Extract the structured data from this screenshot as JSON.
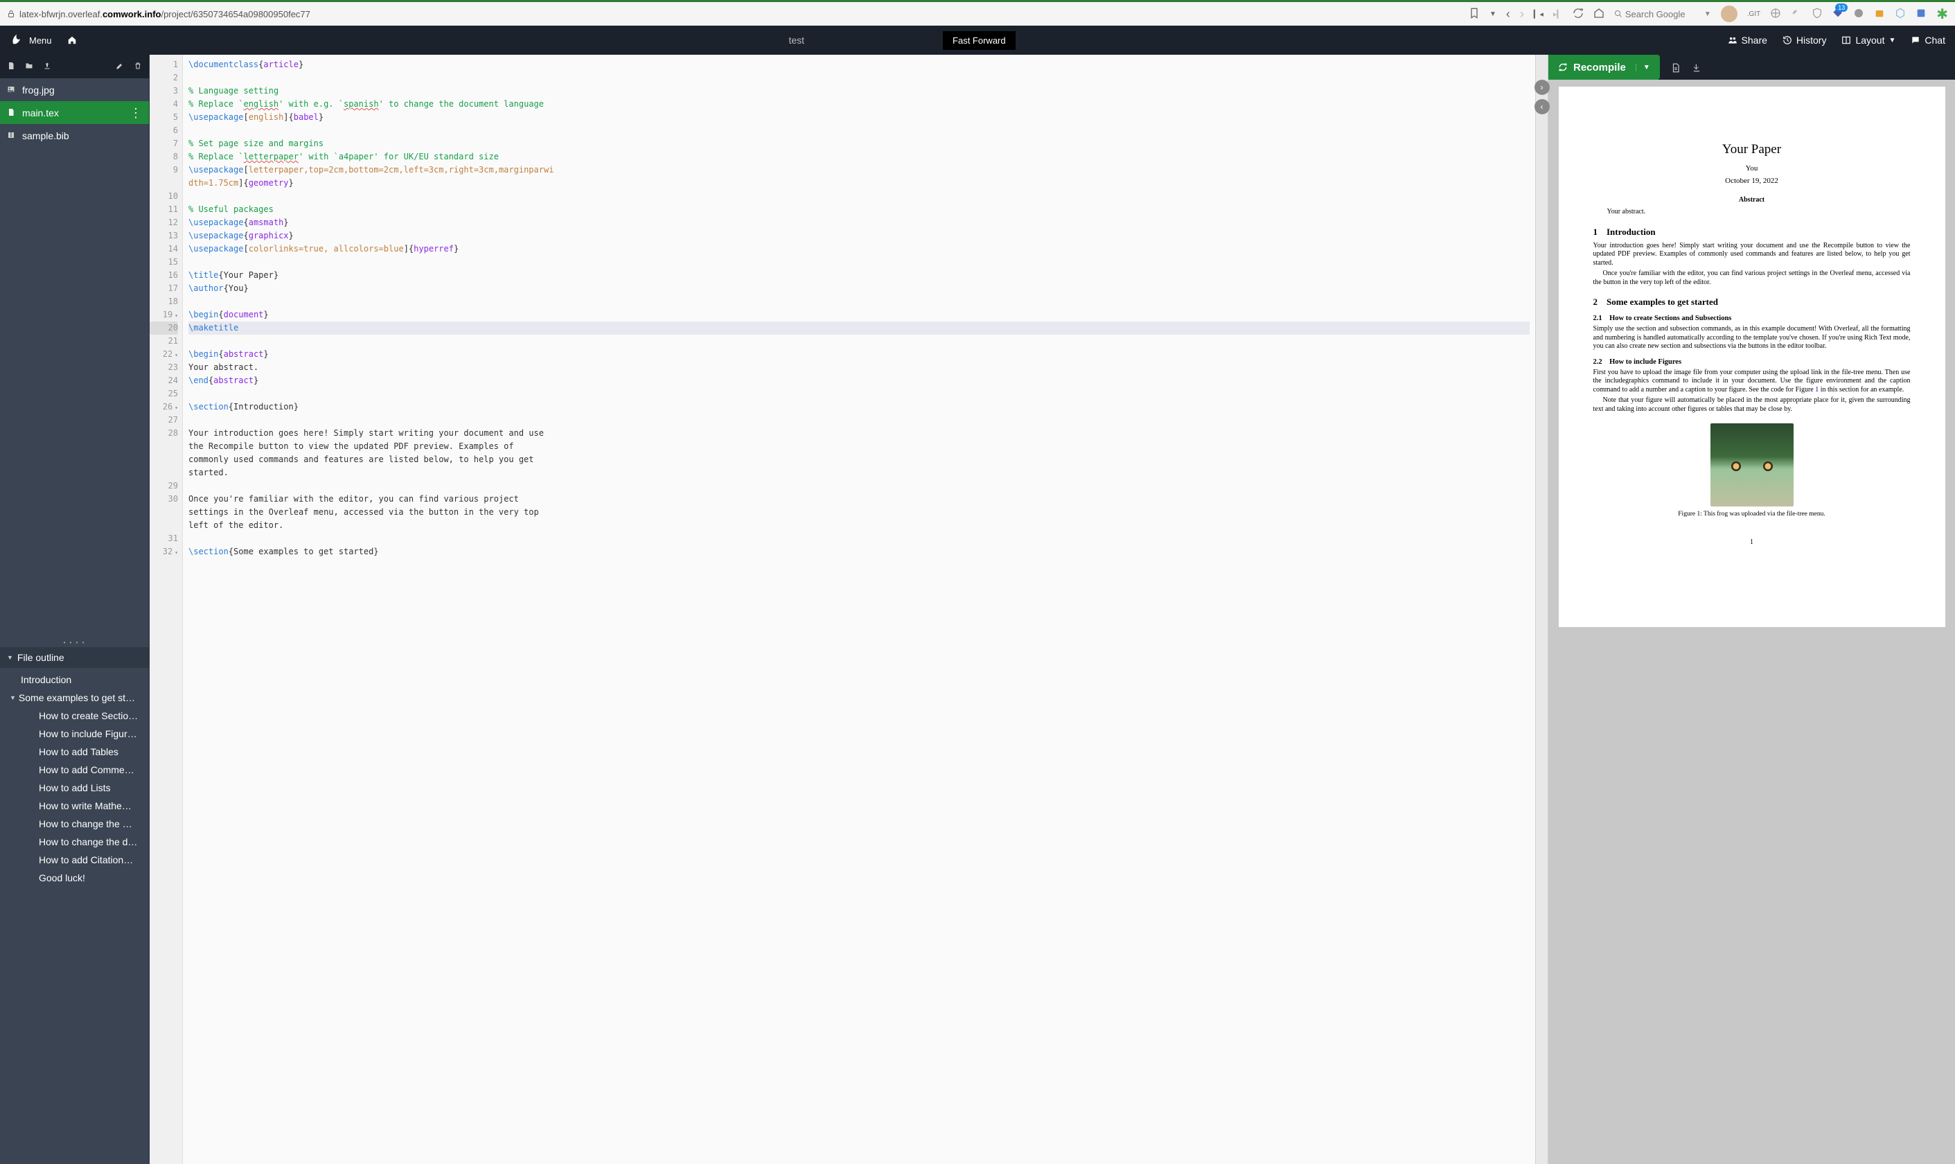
{
  "browser": {
    "url_prefix": "latex-bfwrjn.overleaf.",
    "url_domain": "comwork.info",
    "url_path": "/project/6350734654a09800950fec77",
    "search_placeholder": "Search Google",
    "git_label": ".GIT",
    "badge_count": "13"
  },
  "header": {
    "menu": "Menu",
    "title": "test",
    "fast_forward": "Fast Forward",
    "share": "Share",
    "history": "History",
    "layout": "Layout",
    "chat": "Chat"
  },
  "files": [
    {
      "icon": "image-icon",
      "name": "frog.jpg",
      "active": false
    },
    {
      "icon": "file-icon",
      "name": "main.tex",
      "active": true
    },
    {
      "icon": "book-icon",
      "name": "sample.bib",
      "active": false
    }
  ],
  "outline": {
    "title": "File outline",
    "items": [
      {
        "label": "Introduction",
        "level": 0
      },
      {
        "label": "Some examples to get st…",
        "level": 0,
        "expandable": true
      },
      {
        "label": "How to create Sectio…",
        "level": 1
      },
      {
        "label": "How to include Figur…",
        "level": 1
      },
      {
        "label": "How to add Tables",
        "level": 1
      },
      {
        "label": "How to add Comme…",
        "level": 1
      },
      {
        "label": "How to add Lists",
        "level": 1
      },
      {
        "label": "How to write Mathe…",
        "level": 1
      },
      {
        "label": "How to change the …",
        "level": 1
      },
      {
        "label": "How to change the d…",
        "level": 1
      },
      {
        "label": "How to add Citation…",
        "level": 1
      },
      {
        "label": "Good luck!",
        "level": 1
      }
    ]
  },
  "recompile": {
    "label": "Recompile"
  },
  "editor": {
    "lines": [
      {
        "n": "1",
        "html": "<span class='cmd'>\\documentclass</span>{<span class='arg'>article</span>}"
      },
      {
        "n": "2",
        "html": ""
      },
      {
        "n": "3",
        "html": "<span class='cmt'>% Language setting</span>"
      },
      {
        "n": "4",
        "html": "<span class='cmt'>% Replace `<span class='squig'>english</span>' with e.g. `<span class='squig'>spanish</span>' to change the document language</span>"
      },
      {
        "n": "5",
        "html": "<span class='cmd'>\\usepackage</span>[<span class='opt'>english</span>]{<span class='arg'>babel</span>}"
      },
      {
        "n": "6",
        "html": ""
      },
      {
        "n": "7",
        "html": "<span class='cmt'>% Set page size and margins</span>"
      },
      {
        "n": "8",
        "html": "<span class='cmt'>% Replace `<span class='squig'>letterpaper</span>' with `a4paper' for UK/EU standard size</span>"
      },
      {
        "n": "9",
        "html": "<span class='cmd'>\\usepackage</span>[<span class='opt'>letterpaper,top=2cm,bottom=2cm,left=3cm,right=3cm,marginparwi</span>"
      },
      {
        "n": "",
        "html": "<span class='opt'>dth=1.75cm</span>]{<span class='arg'>geometry</span>}"
      },
      {
        "n": "10",
        "html": ""
      },
      {
        "n": "11",
        "html": "<span class='cmt'>% Useful packages</span>"
      },
      {
        "n": "12",
        "html": "<span class='cmd'>\\usepackage</span>{<span class='arg'>amsmath</span>}"
      },
      {
        "n": "13",
        "html": "<span class='cmd'>\\usepackage</span>{<span class='arg'>graphicx</span>}"
      },
      {
        "n": "14",
        "html": "<span class='cmd'>\\usepackage</span>[<span class='opt'>colorlinks=true, allcolors=blue</span>]{<span class='arg'>hyperref</span>}"
      },
      {
        "n": "15",
        "html": ""
      },
      {
        "n": "16",
        "html": "<span class='cmd'>\\title</span>{Your Paper}"
      },
      {
        "n": "17",
        "html": "<span class='cmd'>\\author</span>{You}"
      },
      {
        "n": "18",
        "html": ""
      },
      {
        "n": "19",
        "html": "<span class='cmd'>\\begin</span>{<span class='arg'>document</span>}",
        "fold": true
      },
      {
        "n": "20",
        "html": "<span class='cmd'>\\maketitle</span>",
        "hl": true
      },
      {
        "n": "21",
        "html": ""
      },
      {
        "n": "22",
        "html": "<span class='cmd'>\\begin</span>{<span class='arg'>abstract</span>}",
        "fold": true
      },
      {
        "n": "23",
        "html": "Your abstract."
      },
      {
        "n": "24",
        "html": "<span class='cmd'>\\end</span>{<span class='arg'>abstract</span>}"
      },
      {
        "n": "25",
        "html": ""
      },
      {
        "n": "26",
        "html": "<span class='cmd'>\\section</span>{Introduction}",
        "fold": true
      },
      {
        "n": "27",
        "html": ""
      },
      {
        "n": "28",
        "html": "Your introduction goes here! Simply start writing your document and use"
      },
      {
        "n": "",
        "html": "the Recompile button to view the updated PDF preview. Examples of "
      },
      {
        "n": "",
        "html": "commonly used commands and features are listed below, to help you get "
      },
      {
        "n": "",
        "html": "started."
      },
      {
        "n": "29",
        "html": ""
      },
      {
        "n": "30",
        "html": "Once you're familiar with the editor, you can find various project "
      },
      {
        "n": "",
        "html": "settings in the Overleaf menu, accessed via the button in the very top "
      },
      {
        "n": "",
        "html": "left of the editor."
      },
      {
        "n": "31",
        "html": ""
      },
      {
        "n": "32",
        "html": "<span class='cmd'>\\section</span>{Some examples to get started}",
        "fold": true
      }
    ]
  },
  "pdf": {
    "title": "Your Paper",
    "author": "You",
    "date": "October 19, 2022",
    "abstract_h": "Abstract",
    "abstract_b": "Your abstract.",
    "s1": "1 Introduction",
    "p1a": "Your introduction goes here! Simply start writing your document and use the Recompile button to view the updated PDF preview. Examples of commonly used commands and features are listed below, to help you get started.",
    "p1b": "Once you're familiar with the editor, you can find various project settings in the Overleaf menu, accessed via the button in the very top left of the editor.",
    "s2": "2 Some examples to get started",
    "s21": "2.1 How to create Sections and Subsections",
    "p21": "Simply use the section and subsection commands, as in this example document! With Overleaf, all the formatting and numbering is handled automatically according to the template you've chosen. If you're using Rich Text mode, you can also create new section and subsections via the buttons in the editor toolbar.",
    "s22": "2.2 How to include Figures",
    "p22a_pre": "First you have to upload the image file from your computer using the upload link in the file-tree menu. Then use the includegraphics command to include it in your document. Use the figure environment and the caption command to add a number and a caption to your figure. See the code for Figure ",
    "p22a_link": "1",
    "p22a_post": " in this section for an example.",
    "p22b": "Note that your figure will automatically be placed in the most appropriate place for it, given the surrounding text and taking into account other figures or tables that may be close by.",
    "figcap": "Figure 1: This frog was uploaded via the file-tree menu.",
    "pagenum": "1"
  }
}
